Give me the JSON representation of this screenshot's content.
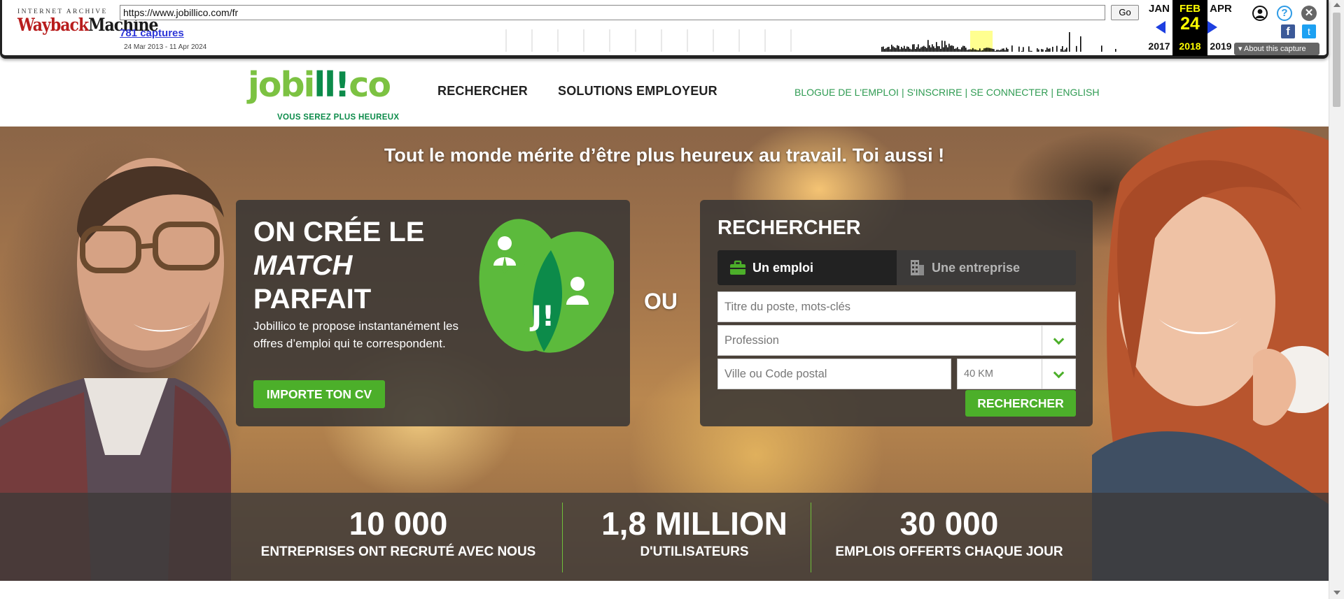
{
  "wayback": {
    "logo_top": "INTERNET ARCHIVE",
    "logo_main_a": "Wayback",
    "logo_main_b": "Machine",
    "url": "https://www.jobillico.com/fr",
    "go_label": "Go",
    "captures_label": "781 captures",
    "date_range": "24 Mar 2013 - 11 Apr 2024",
    "prev_month": "JAN",
    "prev_year": "2017",
    "cur_month": "FEB",
    "cur_day": "24",
    "cur_year": "2018",
    "next_month": "APR",
    "next_year": "2019",
    "about_label": "About this capture",
    "help_glyph": "?",
    "close_glyph": "✕",
    "fb_glyph": "f",
    "tw_glyph": "t",
    "icons": [
      "user-icon",
      "help-icon",
      "close-icon",
      "facebook-icon",
      "twitter-icon",
      "prev-arrow-icon",
      "next-arrow-icon"
    ]
  },
  "header": {
    "logo_a": "jobi",
    "logo_b": "ll!",
    "logo_c": "co",
    "tagline": "VOUS SEREZ PLUS HEUREUX",
    "nav": [
      "RECHERCHER",
      "SOLUTIONS EMPLOYEUR"
    ],
    "links": [
      "BLOGUE DE L'EMPLOI",
      "S'INSCRIRE",
      "SE CONNECTER",
      "ENGLISH"
    ],
    "link_sep": "|"
  },
  "hero": {
    "headline": "Tout le monde mérite d’être plus heureux au travail. Toi aussi !",
    "match_title_1": "ON CRÉE LE",
    "match_title_2": "MATCH",
    "match_title_3": "PARFAIT",
    "match_desc": "Jobillico te propose instantanément les offres d’emploi qui te correspondent.",
    "import_button": "IMPORTE TON CV",
    "graphic_label": "J!",
    "or_label": "OU",
    "search_title": "RECHERCHER",
    "tabs": [
      "Un emploi",
      "Une entreprise"
    ],
    "title_placeholder": "Titre du poste, mots-clés",
    "profession_placeholder": "Profession",
    "city_placeholder": "Ville ou Code postal",
    "distance_value": "40 KM",
    "search_button": "RECHERCHER"
  },
  "stats": [
    {
      "number": "10 000",
      "label": "ENTREPRISES ONT RECRUTÉ AVEC NOUS"
    },
    {
      "number": "1,8 MILLION",
      "label": "D'UTILISATEURS"
    },
    {
      "number": "30 000",
      "label": "EMPLOIS OFFERTS CHAQUE JOUR"
    }
  ],
  "colors": {
    "brand_green": "#7cc242",
    "brand_dark_green": "#0c8b4a",
    "button_green": "#4caf2a",
    "link_green": "#2f9b52",
    "wayback_highlight": "#ffff00"
  }
}
